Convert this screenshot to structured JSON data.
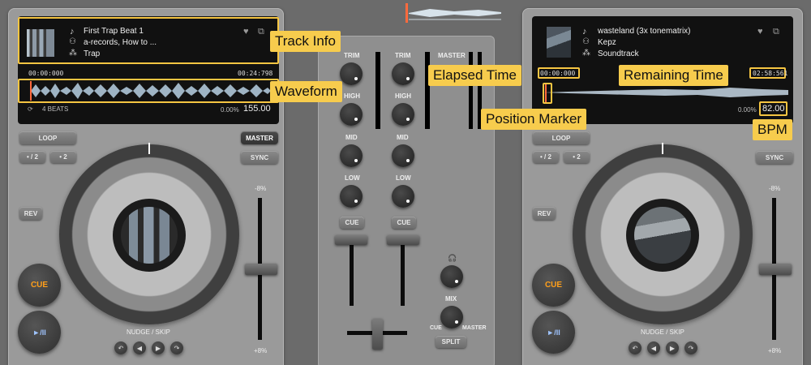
{
  "colors": {
    "accent": "#f5c542",
    "cue_text": "#ff9f1a",
    "marker": "#ff6a3d"
  },
  "deck_left": {
    "track_title": "First Trap Beat 1",
    "artist": "a-records, How to ...",
    "genre": "Trap",
    "elapsed": "00:00:000",
    "remaining": "00:24:798",
    "beats": "4 BEATS",
    "pitch": "0.00%",
    "bpm": "155.00",
    "loop": "LOOP",
    "half": "• / 2",
    "double": "• 2",
    "master": "MASTER",
    "sync": "SYNC",
    "rev": "REV",
    "cue": "CUE",
    "play": "►/II",
    "nudge_label": "NUDGE / SKIP",
    "pitch_max": "-8%",
    "pitch_min": "+8%"
  },
  "deck_right": {
    "track_title": "wasteland (3x tonematrix)",
    "artist": "Kepz",
    "genre": "Soundtrack",
    "elapsed": "00:00:000",
    "remaining": "02:58:561",
    "pitch": "0.00%",
    "bpm": "82.00",
    "loop": "LOOP",
    "half": "• / 2",
    "double": "• 2",
    "sync": "SYNC",
    "rev": "REV",
    "cue": "CUE",
    "play": "►/II",
    "nudge_label": "NUDGE / SKIP",
    "pitch_max": "-8%",
    "pitch_min": "+8%"
  },
  "mixer": {
    "trim": "TRIM",
    "high": "HIGH",
    "mid": "MID",
    "low": "LOW",
    "cue": "CUE",
    "master": "MASTER",
    "mix": "MIX",
    "mix_cue": "CUE",
    "mix_master": "MASTER",
    "split": "SPLIT"
  },
  "callouts": {
    "track_info": "Track Info",
    "waveform": "Waveform",
    "elapsed_time": "Elapsed Time",
    "remaining_time": "Remaining Time",
    "position_marker": "Position Marker",
    "bpm": "BPM"
  },
  "icons": {
    "note": "music-note-icon",
    "artist": "people-icon",
    "genre": "genre-icon",
    "heart": "heart-icon",
    "external": "external-link-icon",
    "beats": "loop-icon",
    "headphones": "headphones-icon"
  }
}
